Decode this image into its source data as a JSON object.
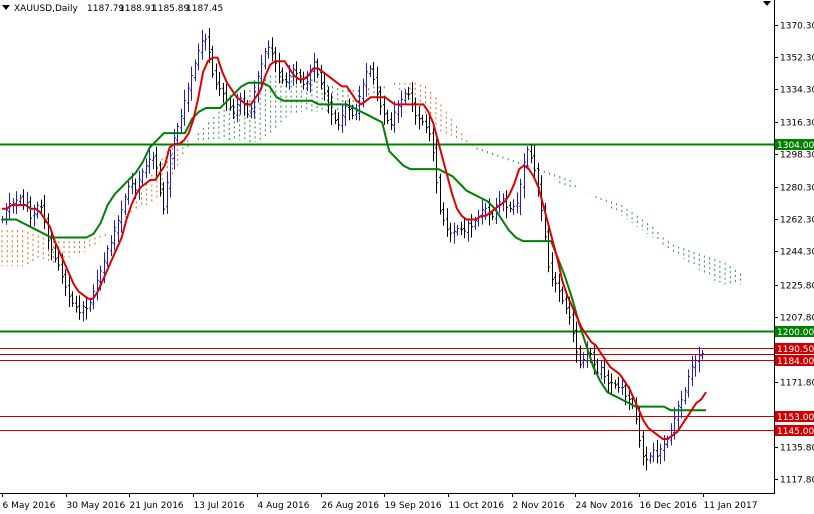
{
  "chart_data": {
    "type": "line",
    "title": "XAUUSD,Daily",
    "ohlc_header": [
      "1187.79",
      "1188.91",
      "1185.89",
      "1187.45"
    ],
    "ylim": [
      1110,
      1384
    ],
    "y_ticks": [
      "1370.30",
      "1352.30",
      "1334.30",
      "1316.30",
      "1298.30",
      "1280.30",
      "1262.30",
      "1244.30",
      "1225.80",
      "1207.80",
      "1189.80",
      "1171.80",
      "1153.80",
      "1135.80",
      "1117.80"
    ],
    "x_ticks": [
      "6 May 2016",
      "30 May 2016",
      "21 Jun 2016",
      "13 Jul 2016",
      "4 Aug 2016",
      "26 Aug 2016",
      "19 Sep 2016",
      "11 Oct 2016",
      "2 Nov 2016",
      "24 Nov 2016",
      "16 Dec 2016",
      "11 Jan 2017"
    ],
    "grid": false,
    "colors": {
      "bull_candle": "#1e1ec8",
      "bear_candle": "#000000",
      "tenkan": "#e00000",
      "kijun": "#008000",
      "cloud_bull": "#2e8b57",
      "cloud_bear": "#d2691e",
      "support": "#d00000",
      "resistance": "#007000",
      "price_line": "#d00000"
    },
    "horizontal_levels": [
      {
        "value": 1304.0,
        "label": "1304.00",
        "color": "#008000"
      },
      {
        "value": 1200.0,
        "label": "1200.00",
        "color": "#008000"
      },
      {
        "value": 1190.5,
        "label": "1190.50",
        "color": "#d00000"
      },
      {
        "value": 1184.0,
        "label": "1184.00",
        "color": "#d00000"
      },
      {
        "value": 1153.0,
        "label": "1153.00",
        "color": "#d00000"
      },
      {
        "value": 1145.0,
        "label": "1145.00",
        "color": "#d00000"
      }
    ],
    "current_price": {
      "value": 1187.45,
      "label": "1187.45"
    },
    "series": [
      {
        "values": [
          1262,
          1268,
          1272,
          1270,
          1276,
          1270,
          1272,
          1262,
          1266,
          1272,
          1266,
          1252,
          1246,
          1240,
          1236,
          1228,
          1222,
          1216,
          1214,
          1210,
          1214,
          1212,
          1218,
          1226,
          1232,
          1238,
          1246,
          1250,
          1258,
          1264,
          1272,
          1280,
          1282,
          1278,
          1286,
          1290,
          1294,
          1298,
          1292,
          1276,
          1266,
          1290,
          1304,
          1312,
          1318,
          1328,
          1336,
          1344,
          1352,
          1360,
          1364,
          1356,
          1342,
          1336,
          1334,
          1330,
          1326,
          1320,
          1326,
          1330,
          1324,
          1318,
          1330,
          1340,
          1348,
          1356,
          1358,
          1352,
          1346,
          1340,
          1338,
          1342,
          1346,
          1342,
          1338,
          1336,
          1344,
          1350,
          1342,
          1336,
          1330,
          1322,
          1318,
          1314,
          1320,
          1326,
          1322,
          1318,
          1328,
          1336,
          1344,
          1346,
          1338,
          1328,
          1322,
          1318,
          1314,
          1322,
          1326,
          1330,
          1334,
          1328,
          1320,
          1318,
          1316,
          1312,
          1308,
          1290,
          1268,
          1262,
          1256,
          1254,
          1256,
          1258,
          1254,
          1260,
          1258,
          1262,
          1264,
          1270,
          1266,
          1262,
          1270,
          1272,
          1274,
          1266,
          1270,
          1268,
          1280,
          1294,
          1302,
          1294,
          1286,
          1272,
          1256,
          1236,
          1228,
          1226,
          1220,
          1214,
          1210,
          1200,
          1188,
          1180,
          1186,
          1190,
          1184,
          1176,
          1180,
          1174,
          1170,
          1172,
          1168,
          1170,
          1164,
          1162,
          1158,
          1148,
          1132,
          1128,
          1130,
          1134,
          1130,
          1136,
          1138,
          1142,
          1150,
          1158,
          1162,
          1168,
          1178,
          1182,
          1186,
          1187.45
        ]
      },
      {
        "name": "Tenkan-sen",
        "values": [
          1268,
          1268,
          1270,
          1270,
          1270,
          1270,
          1268,
          1268,
          1266,
          1262,
          1258,
          1250,
          1244,
          1238,
          1232,
          1226,
          1222,
          1220,
          1218,
          1218,
          1222,
          1228,
          1234,
          1240,
          1246,
          1252,
          1262,
          1270,
          1276,
          1280,
          1282,
          1284,
          1284,
          1288,
          1292,
          1302,
          1304,
          1304,
          1306,
          1310,
          1318,
          1330,
          1344,
          1350,
          1352,
          1352,
          1344,
          1338,
          1334,
          1330,
          1328,
          1326,
          1326,
          1330,
          1334,
          1342,
          1348,
          1350,
          1350,
          1350,
          1346,
          1342,
          1340,
          1340,
          1342,
          1346,
          1346,
          1344,
          1342,
          1340,
          1338,
          1336,
          1336,
          1332,
          1328,
          1326,
          1328,
          1330,
          1330,
          1330,
          1330,
          1328,
          1326,
          1326,
          1326,
          1326,
          1326,
          1326,
          1326,
          1322,
          1316,
          1306,
          1296,
          1286,
          1276,
          1268,
          1264,
          1262,
          1262,
          1262,
          1264,
          1264,
          1266,
          1268,
          1270,
          1272,
          1276,
          1282,
          1290,
          1292,
          1290,
          1286,
          1280,
          1270,
          1260,
          1250,
          1240,
          1228,
          1220,
          1214,
          1208,
          1202,
          1198,
          1194,
          1192,
          1188,
          1184,
          1180,
          1178,
          1176,
          1172,
          1168,
          1162,
          1156,
          1150,
          1146,
          1144,
          1142,
          1140,
          1140,
          1142,
          1144,
          1148,
          1152,
          1156,
          1160,
          1162,
          1166
        ]
      },
      {
        "name": "Kijun-sen",
        "values": [
          1262,
          1262,
          1262,
          1260,
          1258,
          1256,
          1254,
          1252,
          1252,
          1252,
          1252,
          1252,
          1252,
          1254,
          1260,
          1270,
          1276,
          1280,
          1284,
          1288,
          1294,
          1302,
          1306,
          1310,
          1310,
          1310,
          1310,
          1318,
          1322,
          1324,
          1324,
          1324,
          1328,
          1332,
          1336,
          1338,
          1338,
          1338,
          1336,
          1330,
          1328,
          1328,
          1328,
          1328,
          1328,
          1326,
          1326,
          1326,
          1326,
          1326,
          1324,
          1322,
          1320,
          1318,
          1316,
          1300,
          1296,
          1292,
          1290,
          1290,
          1290,
          1290,
          1290,
          1288,
          1286,
          1282,
          1278,
          1276,
          1274,
          1272,
          1268,
          1262,
          1256,
          1252,
          1250,
          1250,
          1250,
          1250,
          1250,
          1240,
          1230,
          1218,
          1204,
          1192,
          1180,
          1172,
          1166,
          1164,
          1162,
          1160,
          1158,
          1158,
          1158,
          1158,
          1158,
          1156,
          1156,
          1156,
          1156,
          1156,
          1156
        ]
      },
      {
        "name": "Senkou Span A",
        "values": [
          1236,
          1236,
          1236,
          1238,
          1240,
          1238,
          1240,
          1242,
          1244,
          1248,
          1252,
          1258,
          1264,
          1268,
          1270,
          1274,
          1282,
          1292,
          1302,
          1310,
          1316,
          1322,
          1324,
          1326,
          1334,
          1338,
          1342,
          1342,
          1342,
          1342,
          1340,
          1338,
          1336,
          1334,
          1334,
          1334,
          1336,
          1336,
          1336,
          1332,
          1326,
          1320,
          1314,
          1308,
          1306,
          1304,
          1302,
          1300,
          1298,
          1296,
          1294,
          1292,
          1290,
          1288,
          1286,
          1284,
          1278,
          1276,
          1274,
          1272,
          1270,
          1266,
          1262,
          1258,
          1252,
          1248,
          1246,
          1244,
          1242,
          1240,
          1238,
          1234,
          1230
        ]
      },
      {
        "name": "Senkou Span B",
        "values": [
          1256,
          1256,
          1256,
          1254,
          1252,
          1250,
          1250,
          1250,
          1250,
          1252,
          1254,
          1256,
          1262,
          1272,
          1282,
          1292,
          1300,
          1304,
          1306,
          1306,
          1306,
          1306,
          1306,
          1306,
          1304,
          1306,
          1310,
          1316,
          1320,
          1322,
          1322,
          1322,
          1322,
          1322,
          1324,
          1326,
          1330,
          1334,
          1338,
          1338,
          1338,
          1336,
          1330,
          1322,
          1314,
          1306,
          1300,
          1298,
          1296,
          1294,
          1292,
          1290,
          1288,
          1286,
          1282,
          1280,
          1278,
          1276,
          1272,
          1268,
          1264,
          1260,
          1256,
          1252,
          1248,
          1244,
          1240,
          1236,
          1232,
          1228,
          1226,
          1226,
          1226
        ]
      }
    ]
  }
}
